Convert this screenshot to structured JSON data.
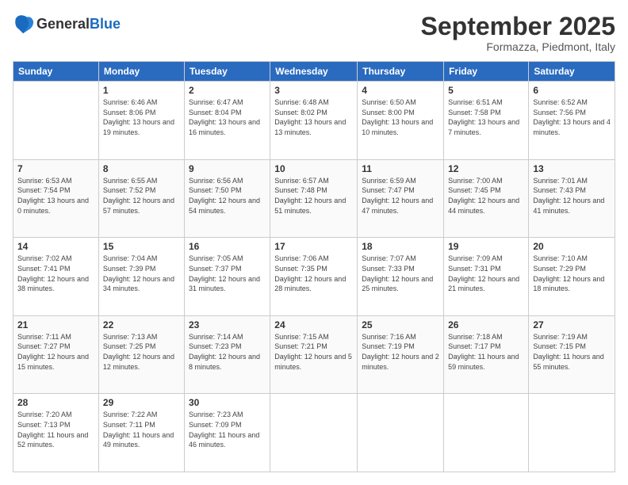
{
  "logo": {
    "text_general": "General",
    "text_blue": "Blue"
  },
  "header": {
    "month_title": "September 2025",
    "subtitle": "Formazza, Piedmont, Italy"
  },
  "days_of_week": [
    "Sunday",
    "Monday",
    "Tuesday",
    "Wednesday",
    "Thursday",
    "Friday",
    "Saturday"
  ],
  "weeks": [
    [
      {
        "day": "",
        "sunrise": "",
        "sunset": "",
        "daylight": ""
      },
      {
        "day": "1",
        "sunrise": "Sunrise: 6:46 AM",
        "sunset": "Sunset: 8:06 PM",
        "daylight": "Daylight: 13 hours and 19 minutes."
      },
      {
        "day": "2",
        "sunrise": "Sunrise: 6:47 AM",
        "sunset": "Sunset: 8:04 PM",
        "daylight": "Daylight: 13 hours and 16 minutes."
      },
      {
        "day": "3",
        "sunrise": "Sunrise: 6:48 AM",
        "sunset": "Sunset: 8:02 PM",
        "daylight": "Daylight: 13 hours and 13 minutes."
      },
      {
        "day": "4",
        "sunrise": "Sunrise: 6:50 AM",
        "sunset": "Sunset: 8:00 PM",
        "daylight": "Daylight: 13 hours and 10 minutes."
      },
      {
        "day": "5",
        "sunrise": "Sunrise: 6:51 AM",
        "sunset": "Sunset: 7:58 PM",
        "daylight": "Daylight: 13 hours and 7 minutes."
      },
      {
        "day": "6",
        "sunrise": "Sunrise: 6:52 AM",
        "sunset": "Sunset: 7:56 PM",
        "daylight": "Daylight: 13 hours and 4 minutes."
      }
    ],
    [
      {
        "day": "7",
        "sunrise": "Sunrise: 6:53 AM",
        "sunset": "Sunset: 7:54 PM",
        "daylight": "Daylight: 13 hours and 0 minutes."
      },
      {
        "day": "8",
        "sunrise": "Sunrise: 6:55 AM",
        "sunset": "Sunset: 7:52 PM",
        "daylight": "Daylight: 12 hours and 57 minutes."
      },
      {
        "day": "9",
        "sunrise": "Sunrise: 6:56 AM",
        "sunset": "Sunset: 7:50 PM",
        "daylight": "Daylight: 12 hours and 54 minutes."
      },
      {
        "day": "10",
        "sunrise": "Sunrise: 6:57 AM",
        "sunset": "Sunset: 7:48 PM",
        "daylight": "Daylight: 12 hours and 51 minutes."
      },
      {
        "day": "11",
        "sunrise": "Sunrise: 6:59 AM",
        "sunset": "Sunset: 7:47 PM",
        "daylight": "Daylight: 12 hours and 47 minutes."
      },
      {
        "day": "12",
        "sunrise": "Sunrise: 7:00 AM",
        "sunset": "Sunset: 7:45 PM",
        "daylight": "Daylight: 12 hours and 44 minutes."
      },
      {
        "day": "13",
        "sunrise": "Sunrise: 7:01 AM",
        "sunset": "Sunset: 7:43 PM",
        "daylight": "Daylight: 12 hours and 41 minutes."
      }
    ],
    [
      {
        "day": "14",
        "sunrise": "Sunrise: 7:02 AM",
        "sunset": "Sunset: 7:41 PM",
        "daylight": "Daylight: 12 hours and 38 minutes."
      },
      {
        "day": "15",
        "sunrise": "Sunrise: 7:04 AM",
        "sunset": "Sunset: 7:39 PM",
        "daylight": "Daylight: 12 hours and 34 minutes."
      },
      {
        "day": "16",
        "sunrise": "Sunrise: 7:05 AM",
        "sunset": "Sunset: 7:37 PM",
        "daylight": "Daylight: 12 hours and 31 minutes."
      },
      {
        "day": "17",
        "sunrise": "Sunrise: 7:06 AM",
        "sunset": "Sunset: 7:35 PM",
        "daylight": "Daylight: 12 hours and 28 minutes."
      },
      {
        "day": "18",
        "sunrise": "Sunrise: 7:07 AM",
        "sunset": "Sunset: 7:33 PM",
        "daylight": "Daylight: 12 hours and 25 minutes."
      },
      {
        "day": "19",
        "sunrise": "Sunrise: 7:09 AM",
        "sunset": "Sunset: 7:31 PM",
        "daylight": "Daylight: 12 hours and 21 minutes."
      },
      {
        "day": "20",
        "sunrise": "Sunrise: 7:10 AM",
        "sunset": "Sunset: 7:29 PM",
        "daylight": "Daylight: 12 hours and 18 minutes."
      }
    ],
    [
      {
        "day": "21",
        "sunrise": "Sunrise: 7:11 AM",
        "sunset": "Sunset: 7:27 PM",
        "daylight": "Daylight: 12 hours and 15 minutes."
      },
      {
        "day": "22",
        "sunrise": "Sunrise: 7:13 AM",
        "sunset": "Sunset: 7:25 PM",
        "daylight": "Daylight: 12 hours and 12 minutes."
      },
      {
        "day": "23",
        "sunrise": "Sunrise: 7:14 AM",
        "sunset": "Sunset: 7:23 PM",
        "daylight": "Daylight: 12 hours and 8 minutes."
      },
      {
        "day": "24",
        "sunrise": "Sunrise: 7:15 AM",
        "sunset": "Sunset: 7:21 PM",
        "daylight": "Daylight: 12 hours and 5 minutes."
      },
      {
        "day": "25",
        "sunrise": "Sunrise: 7:16 AM",
        "sunset": "Sunset: 7:19 PM",
        "daylight": "Daylight: 12 hours and 2 minutes."
      },
      {
        "day": "26",
        "sunrise": "Sunrise: 7:18 AM",
        "sunset": "Sunset: 7:17 PM",
        "daylight": "Daylight: 11 hours and 59 minutes."
      },
      {
        "day": "27",
        "sunrise": "Sunrise: 7:19 AM",
        "sunset": "Sunset: 7:15 PM",
        "daylight": "Daylight: 11 hours and 55 minutes."
      }
    ],
    [
      {
        "day": "28",
        "sunrise": "Sunrise: 7:20 AM",
        "sunset": "Sunset: 7:13 PM",
        "daylight": "Daylight: 11 hours and 52 minutes."
      },
      {
        "day": "29",
        "sunrise": "Sunrise: 7:22 AM",
        "sunset": "Sunset: 7:11 PM",
        "daylight": "Daylight: 11 hours and 49 minutes."
      },
      {
        "day": "30",
        "sunrise": "Sunrise: 7:23 AM",
        "sunset": "Sunset: 7:09 PM",
        "daylight": "Daylight: 11 hours and 46 minutes."
      },
      {
        "day": "",
        "sunrise": "",
        "sunset": "",
        "daylight": ""
      },
      {
        "day": "",
        "sunrise": "",
        "sunset": "",
        "daylight": ""
      },
      {
        "day": "",
        "sunrise": "",
        "sunset": "",
        "daylight": ""
      },
      {
        "day": "",
        "sunrise": "",
        "sunset": "",
        "daylight": ""
      }
    ]
  ]
}
